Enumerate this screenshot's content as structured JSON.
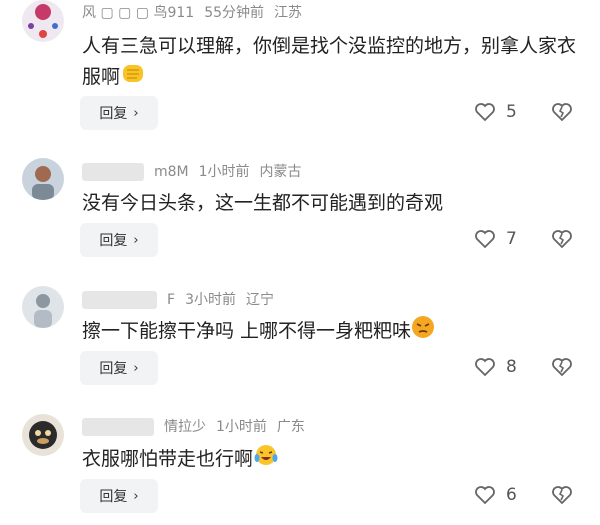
{
  "comments": [
    {
      "username": "风 ▢ ▢ ▢ 鸟911",
      "time": "55分钟前",
      "location": "江苏",
      "text": "人有三急可以理解，你倒是找个没监控的地方，别拿人家衣服啊",
      "emoji": "fist-emoji",
      "reply_label": "回复",
      "likes": "5"
    },
    {
      "username": "m8M",
      "time": "1小时前",
      "location": "内蒙古",
      "text": "没有今日头条，这一生都不可能遇到的奇观",
      "reply_label": "回复",
      "likes": "7"
    },
    {
      "username": "F",
      "time": "3小时前",
      "location": "辽宁",
      "text": "擦一下能擦干净吗 上哪不得一身粑粑味",
      "emoji": "angry-face-emoji",
      "reply_label": "回复",
      "likes": "8"
    },
    {
      "username": "情拉少",
      "time": "1小时前",
      "location": "广东",
      "text": "衣服哪怕带走也行啊",
      "emoji": "laughing-crying-emoji",
      "reply_label": "回复",
      "likes": "6"
    }
  ]
}
